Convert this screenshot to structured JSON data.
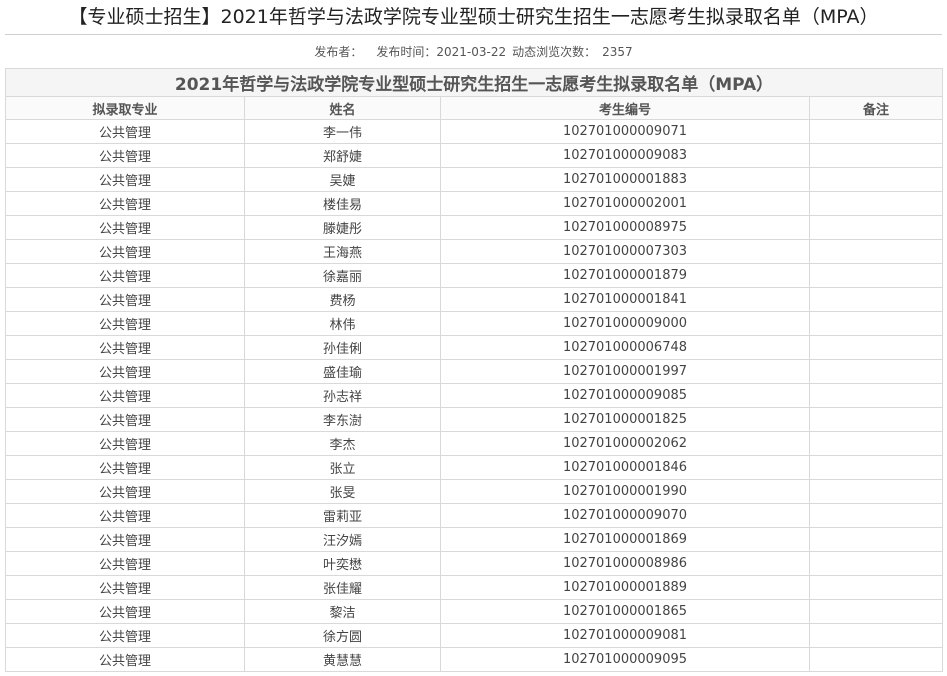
{
  "article": {
    "title": "【专业硕士招生】2021年哲学与法政学院专业型硕士研究生招生一志愿考生拟录取名单（MPA）",
    "publisher_label": "发布者：",
    "publish_time_label": "发布时间：",
    "publish_time": "2021-03-22",
    "views_label": "动态浏览次数：",
    "views": "2357"
  },
  "table": {
    "caption": "2021年哲学与法政学院专业型硕士研究生招生一志愿考生拟录取名单（MPA）",
    "headers": [
      "拟录取专业",
      "姓名",
      "考生编号",
      "备注"
    ],
    "rows": [
      {
        "major": "公共管理",
        "name": "李一伟",
        "id": "102701000009071",
        "note": ""
      },
      {
        "major": "公共管理",
        "name": "郑舒婕",
        "id": "102701000009083",
        "note": ""
      },
      {
        "major": "公共管理",
        "name": "吴婕",
        "id": "102701000001883",
        "note": ""
      },
      {
        "major": "公共管理",
        "name": "楼佳易",
        "id": "102701000002001",
        "note": ""
      },
      {
        "major": "公共管理",
        "name": "滕婕彤",
        "id": "102701000008975",
        "note": ""
      },
      {
        "major": "公共管理",
        "name": "王海燕",
        "id": "102701000007303",
        "note": ""
      },
      {
        "major": "公共管理",
        "name": "徐嘉丽",
        "id": "102701000001879",
        "note": ""
      },
      {
        "major": "公共管理",
        "name": "费杨",
        "id": "102701000001841",
        "note": ""
      },
      {
        "major": "公共管理",
        "name": "林伟",
        "id": "102701000009000",
        "note": ""
      },
      {
        "major": "公共管理",
        "name": "孙佳俐",
        "id": "102701000006748",
        "note": ""
      },
      {
        "major": "公共管理",
        "name": "盛佳瑜",
        "id": "102701000001997",
        "note": ""
      },
      {
        "major": "公共管理",
        "name": "孙志祥",
        "id": "102701000009085",
        "note": ""
      },
      {
        "major": "公共管理",
        "name": "李东澍",
        "id": "102701000001825",
        "note": ""
      },
      {
        "major": "公共管理",
        "name": "李杰",
        "id": "102701000002062",
        "note": ""
      },
      {
        "major": "公共管理",
        "name": "张立",
        "id": "102701000001846",
        "note": ""
      },
      {
        "major": "公共管理",
        "name": "张旻",
        "id": "102701000001990",
        "note": ""
      },
      {
        "major": "公共管理",
        "name": "雷莉亚",
        "id": "102701000009070",
        "note": ""
      },
      {
        "major": "公共管理",
        "name": "汪汐嫣",
        "id": "102701000001869",
        "note": ""
      },
      {
        "major": "公共管理",
        "name": "叶奕懋",
        "id": "102701000008986",
        "note": ""
      },
      {
        "major": "公共管理",
        "name": "张佳耀",
        "id": "102701000001889",
        "note": ""
      },
      {
        "major": "公共管理",
        "name": "黎洁",
        "id": "102701000001865",
        "note": ""
      },
      {
        "major": "公共管理",
        "name": "徐方圆",
        "id": "102701000009081",
        "note": ""
      },
      {
        "major": "公共管理",
        "name": "黄慧慧",
        "id": "102701000009095",
        "note": ""
      }
    ]
  }
}
